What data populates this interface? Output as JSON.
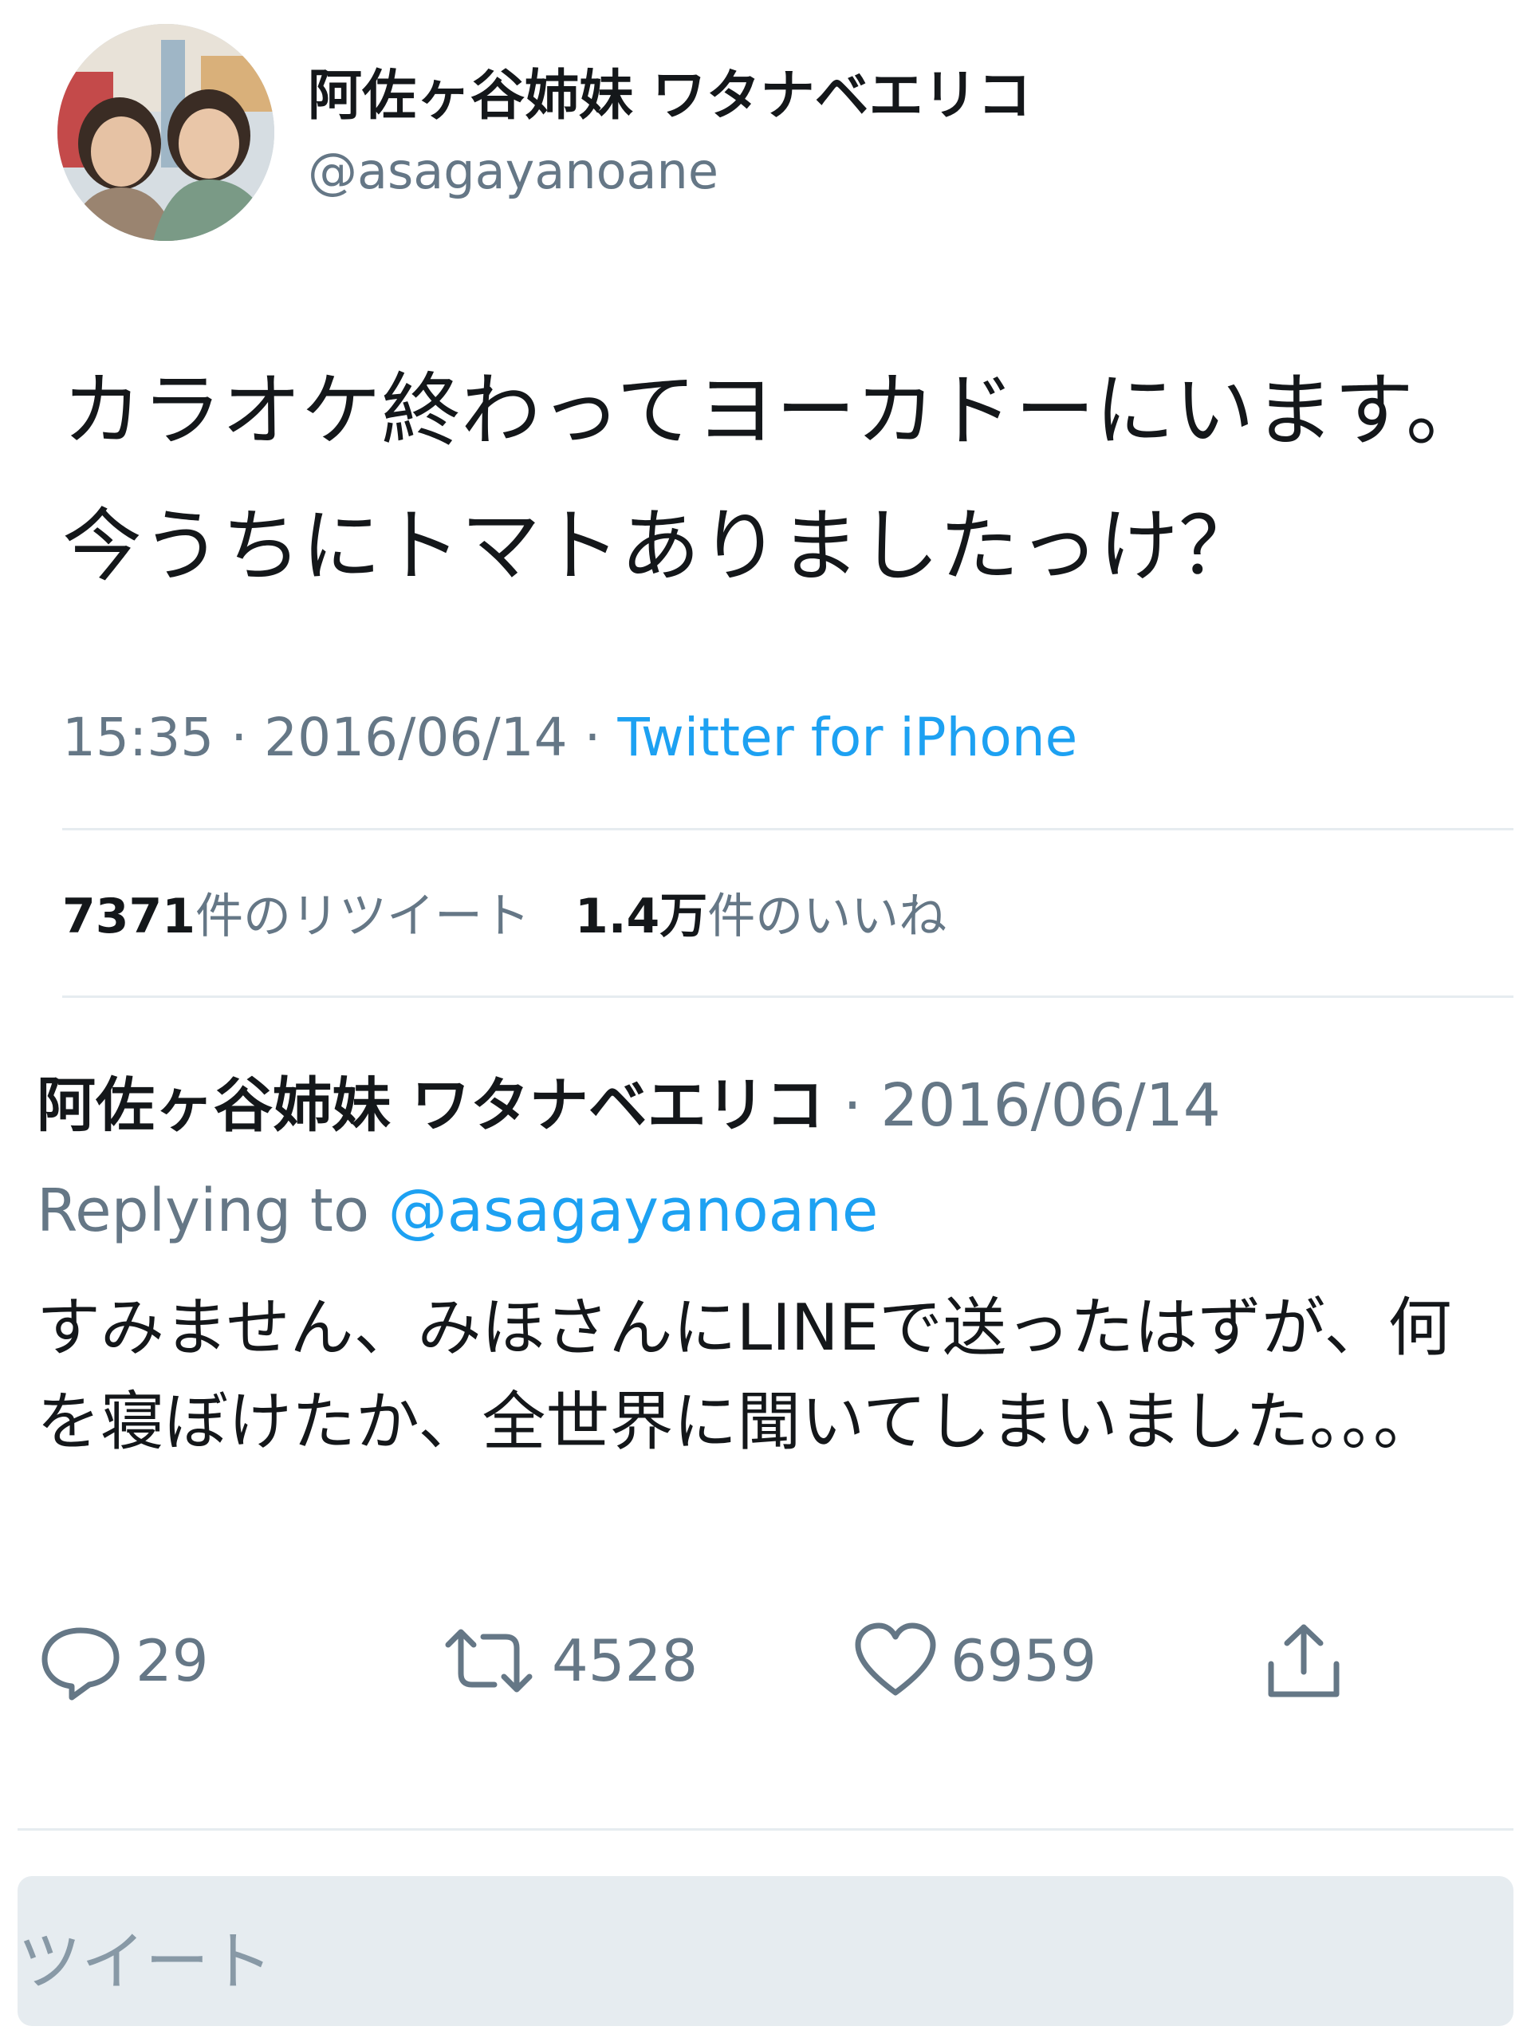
{
  "profile": {
    "display_name": "阿佐ヶ谷姉妹 ワタナベエリコ",
    "handle": "@asagayanoane"
  },
  "tweet": {
    "text": "カラオケ終わってヨーカドーにいます。今うちにトマトありましたっけ？",
    "time": "15:35",
    "date": "2016/06/14",
    "separator": "·",
    "source": "Twitter for iPhone"
  },
  "stats": {
    "retweets_count": "7371",
    "retweets_label": "件のリツイート",
    "likes_count": "1.4万",
    "likes_label": "件のいいね"
  },
  "reply": {
    "display_name": "阿佐ヶ谷姉妹 ワタナベエリコ",
    "date": "· 2016/06/14",
    "replying_prefix": "Replying to",
    "replying_handle": "@asagayanoane",
    "text": "すみません、みほさんにLINEで送ったはずが、何を寝ぼけたか、全世界に聞いてしまいました。。。"
  },
  "actions": {
    "reply_count": "29",
    "retweet_count": "4528",
    "like_count": "6959"
  },
  "compose": {
    "placeholder": "ツイート"
  },
  "icons": {
    "reply": "reply-icon",
    "retweet": "retweet-icon",
    "like": "heart-icon",
    "share": "share-icon"
  },
  "colors": {
    "link": "#1da1f2",
    "secondary_text": "#657786",
    "primary_text": "#14171a",
    "divider": "#e6ecf0"
  }
}
